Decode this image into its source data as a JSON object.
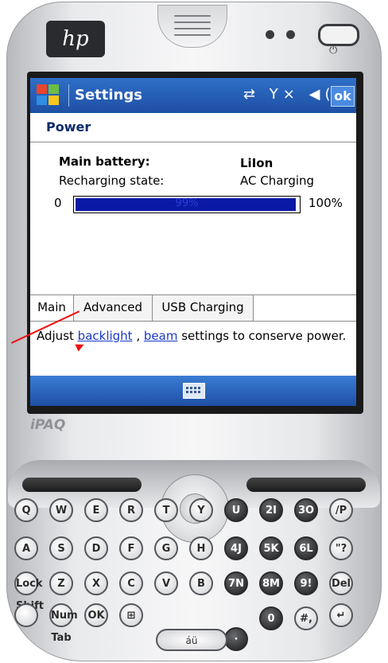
{
  "device": {
    "brand_logo": "hp",
    "model_label": "iPAQ",
    "power_glyph": "⏻"
  },
  "titlebar": {
    "title": "Settings",
    "start_icon": "windows-flag-icon",
    "status_icons": "⇄ Y× ◀(",
    "ok_label": "ok"
  },
  "page": {
    "heading": "Power",
    "main_battery_label": "Main battery:",
    "main_battery_value": "LiIon",
    "recharging_label": "Recharging state:",
    "recharging_value": "AC Charging",
    "progress_min": "0",
    "progress_max": "100%",
    "progress_text": "99%",
    "progress_fraction": 0.99
  },
  "tabs": [
    {
      "label": "Main",
      "active": true
    },
    {
      "label": "Advanced",
      "active": false
    },
    {
      "label": "USB Charging",
      "active": false
    }
  ],
  "description": {
    "prefix": "Adjust ",
    "link1": "backlight",
    "middle": " , ",
    "link2": "beam",
    "suffix": "  settings to conserve power."
  },
  "menubar": {
    "keyboard_icon": "keyboard-icon"
  },
  "keys": [
    {
      "id": "q",
      "label": "Q",
      "tone": "light"
    },
    {
      "id": "w",
      "label": "W",
      "tone": "light"
    },
    {
      "id": "e",
      "label": "E",
      "tone": "light"
    },
    {
      "id": "r",
      "label": "R",
      "tone": "light"
    },
    {
      "id": "t",
      "label": "T",
      "tone": "light"
    },
    {
      "id": "y",
      "label": "Y",
      "tone": "light"
    },
    {
      "id": "u",
      "label": "U",
      "tone": "dark"
    },
    {
      "id": "i",
      "label": "2I",
      "tone": "dark"
    },
    {
      "id": "o",
      "label": "3O",
      "tone": "dark"
    },
    {
      "id": "p",
      "label": "/P",
      "tone": "light"
    },
    {
      "id": "a",
      "label": "A",
      "tone": "light"
    },
    {
      "id": "s",
      "label": "S",
      "tone": "light"
    },
    {
      "id": "d",
      "label": "D",
      "tone": "light"
    },
    {
      "id": "f",
      "label": "F",
      "tone": "light"
    },
    {
      "id": "g",
      "label": "G",
      "tone": "light"
    },
    {
      "id": "h",
      "label": "H",
      "tone": "light"
    },
    {
      "id": "j",
      "label": "4J",
      "tone": "dark"
    },
    {
      "id": "k",
      "label": "5K",
      "tone": "dark"
    },
    {
      "id": "l",
      "label": "6L",
      "tone": "dark"
    },
    {
      "id": "question",
      "label": "\"?",
      "tone": "light"
    },
    {
      "id": "lockshift",
      "label": "Lock Shift",
      "tone": "light"
    },
    {
      "id": "z",
      "label": "Z",
      "tone": "light"
    },
    {
      "id": "x",
      "label": "X",
      "tone": "light"
    },
    {
      "id": "c",
      "label": "C",
      "tone": "light"
    },
    {
      "id": "v",
      "label": "V",
      "tone": "light"
    },
    {
      "id": "b",
      "label": "B",
      "tone": "light"
    },
    {
      "id": "n",
      "label": "7N",
      "tone": "dark"
    },
    {
      "id": "m",
      "label": "8M",
      "tone": "dark"
    },
    {
      "id": "excl",
      "label": "9!",
      "tone": "dark"
    },
    {
      "id": "del",
      "label": "Del",
      "tone": "light"
    },
    {
      "id": "circle",
      "label": "",
      "tone": "light"
    },
    {
      "id": "numtab",
      "label": "Num Tab",
      "tone": "light"
    },
    {
      "id": "ok",
      "label": "OK",
      "tone": "light"
    },
    {
      "id": "start",
      "label": "⊞",
      "tone": "light"
    },
    {
      "id": "dot",
      "label": "·",
      "tone": "dark"
    },
    {
      "id": "zero",
      "label": "0",
      "tone": "dark"
    },
    {
      "id": "quote",
      "label": "#,",
      "tone": "light"
    },
    {
      "id": "enter",
      "label": "↵",
      "tone": "light"
    }
  ],
  "space_label": "áü"
}
